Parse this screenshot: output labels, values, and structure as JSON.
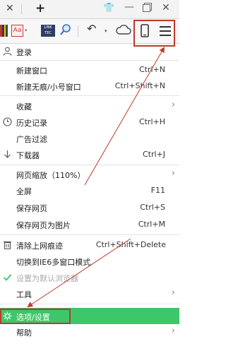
{
  "tabstrip": {
    "close_glyph": "✕",
    "new_tab_glyph": "+",
    "skin_glyph": "👕",
    "minimize_glyph": "—",
    "close_window_glyph": "✕"
  },
  "toolbar": {
    "ext2_label": "Aa",
    "ext3_label": "LINK TEC",
    "undo_glyph": "↶",
    "caret_glyph": "▾"
  },
  "menu": {
    "login": "登录",
    "new_window": {
      "label": "新建窗口",
      "shortcut": "Ctrl+N"
    },
    "new_incognito": {
      "label": "新建无痕/小号窗口",
      "shortcut": "Ctrl+Shift+N"
    },
    "favorites": "收藏",
    "history": {
      "label": "历史记录",
      "shortcut": "Ctrl+H"
    },
    "ad_filter": "广告过滤",
    "downloads": {
      "label": "下载器",
      "shortcut": "Ctrl+J"
    },
    "zoom": "网页缩放（110%）",
    "fullscreen": {
      "label": "全屏",
      "shortcut": "F11"
    },
    "save_page": {
      "label": "保存网页",
      "shortcut": "Ctrl+S"
    },
    "save_as_image": {
      "label": "保存网页为图片",
      "shortcut": "Ctrl+M"
    },
    "clear_traces": {
      "label": "清除上网痕迹",
      "shortcut": "Ctrl+Shift+Delete"
    },
    "ie6_mode": "切换到IE6多窗口模式",
    "set_default": "设置为默认浏览器",
    "tools": "工具",
    "options": "选项/设置",
    "help": "帮助",
    "submenu_glyph": "›"
  },
  "colors": {
    "highlight": "#3dc76a",
    "annotation_red": "#c0392b"
  }
}
